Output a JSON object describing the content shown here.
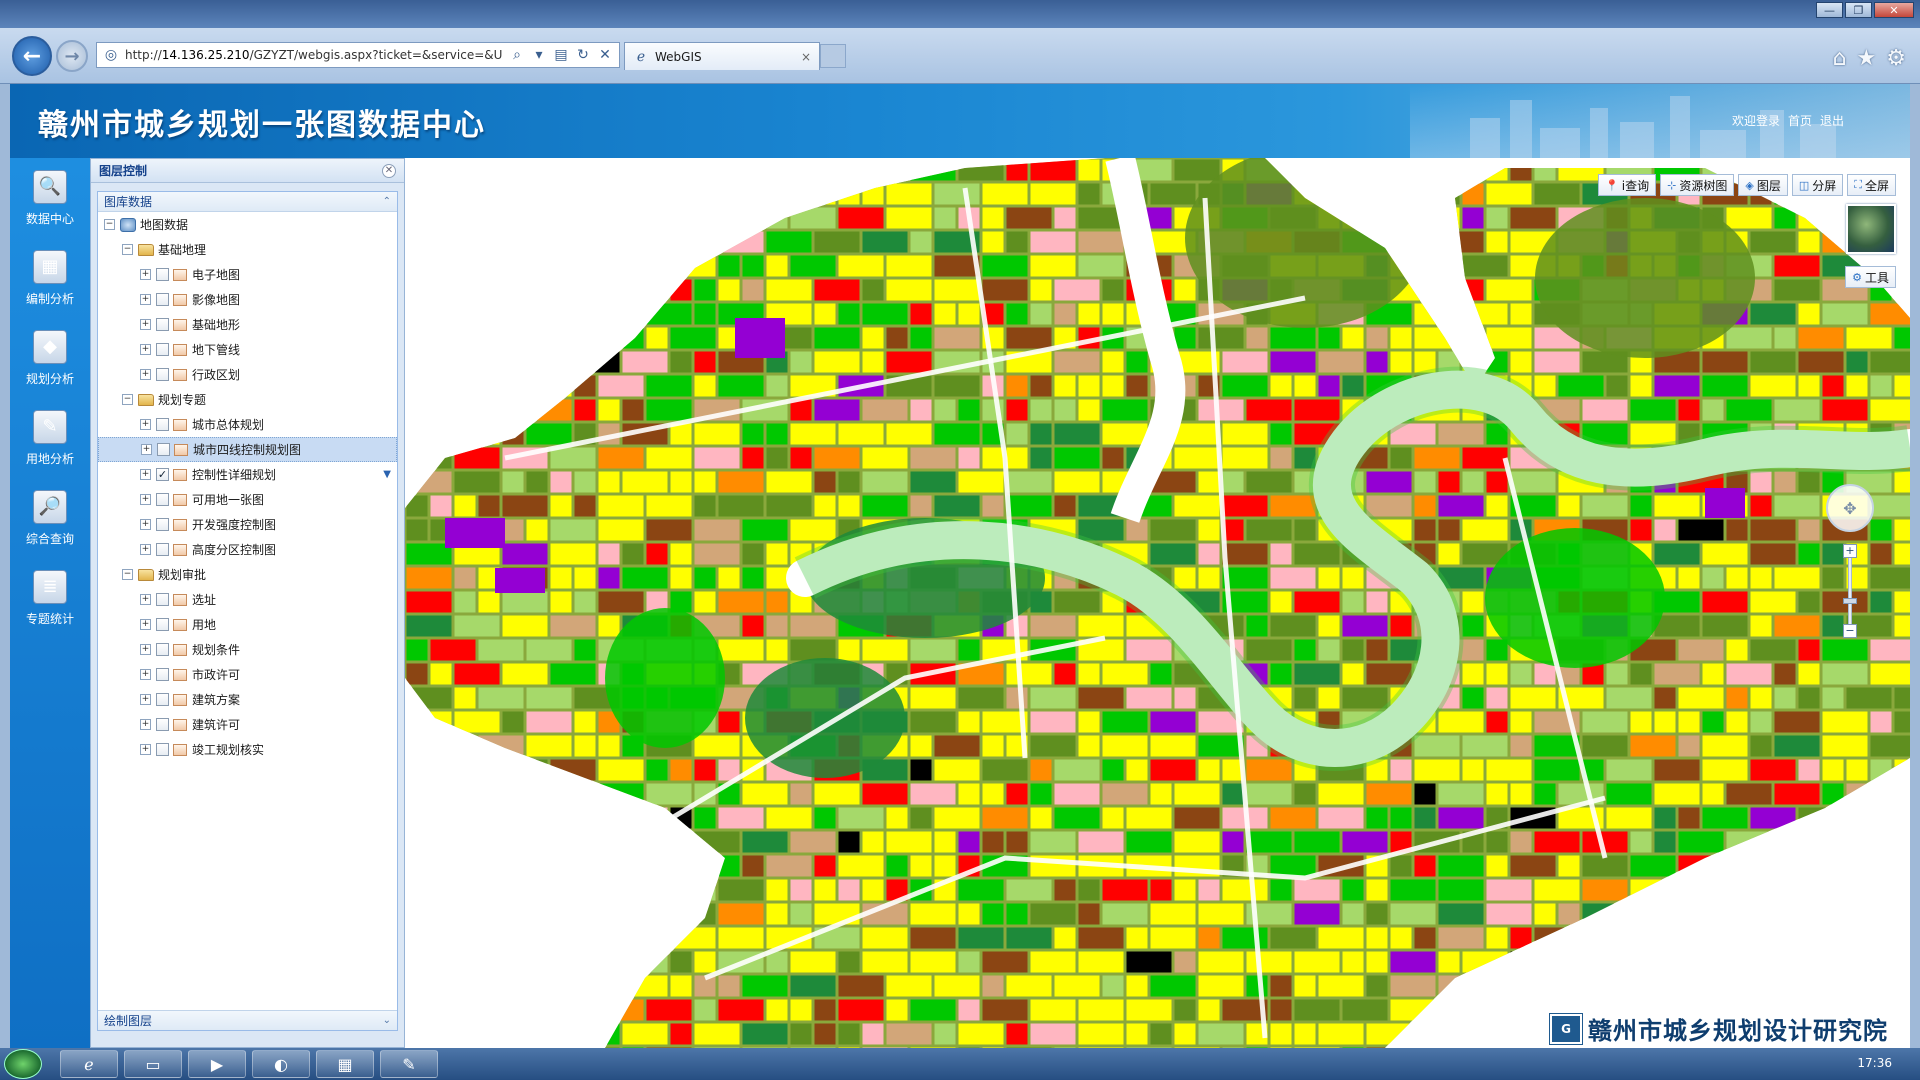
{
  "browser": {
    "url_prefix": "http://",
    "url_host": "14.136.25.210",
    "url_path": "/GZYZT/webgis.aspx?ticket=&service=&UID=",
    "tab_title": "WebGIS",
    "tab_close": "×",
    "window_controls": [
      "—",
      "❐",
      "✕"
    ],
    "right_icons": [
      "home-icon",
      "star-icon",
      "gear-icon"
    ]
  },
  "header": {
    "title": "赣州市城乡规划一张图数据中心",
    "links": [
      "欢迎登录",
      "首页",
      "退出"
    ]
  },
  "sidebar": {
    "items": [
      {
        "label": "数据中心",
        "icon": "data-center-icon",
        "glyph": "🔍"
      },
      {
        "label": "编制分析",
        "icon": "compile-analysis-icon",
        "glyph": "▦"
      },
      {
        "label": "规划分析",
        "icon": "planning-analysis-icon",
        "glyph": "◆"
      },
      {
        "label": "用地分析",
        "icon": "landuse-analysis-icon",
        "glyph": "✎"
      },
      {
        "label": "综合查询",
        "icon": "query-icon",
        "glyph": "🔎"
      },
      {
        "label": "专题统计",
        "icon": "statistics-icon",
        "glyph": "≣"
      }
    ]
  },
  "layer_panel": {
    "title": "图层控制",
    "section_top": "图库数据",
    "section_bottom": "绘制图层",
    "root": "地图数据",
    "groups": [
      {
        "label": "基础地理",
        "items": [
          "电子地图",
          "影像地图",
          "基础地形",
          "地下管线",
          "行政区划"
        ]
      },
      {
        "label": "规划专题",
        "items": [
          "城市总体规划",
          "城市四线控制规划图",
          "控制性详细规划",
          "可用地一张图",
          "开发强度控制图",
          "高度分区控制图"
        ]
      },
      {
        "label": "规划审批",
        "items": [
          "选址",
          "用地",
          "规划条件",
          "市政许可",
          "建筑方案",
          "建筑许可",
          "竣工规划核实"
        ]
      }
    ],
    "selected_item": "城市四线控制规划图",
    "checked_item": "控制性详细规划"
  },
  "map": {
    "toolbar": [
      "i查询",
      "资源树图",
      "图层",
      "分屏",
      "全屏"
    ],
    "tools_label": "工具",
    "zoom_in": "+",
    "zoom_out": "−"
  },
  "watermark": {
    "logo": "G",
    "text": "赣州市城乡规划设计研究院"
  },
  "taskbar": {
    "clock": "17:36"
  },
  "colors": {
    "header_blue": "#1a86d2",
    "sidebar_blue": "#1e8ee0",
    "river": "#ffffff",
    "landuse": [
      "#ffff00",
      "#ff0000",
      "#8b4513",
      "#a6d96a",
      "#00c800",
      "#9400d3",
      "#ff8c00",
      "#ffb6c1",
      "#d2a679",
      "#5f8f1f",
      "#1e8a3a",
      "#000000"
    ]
  }
}
